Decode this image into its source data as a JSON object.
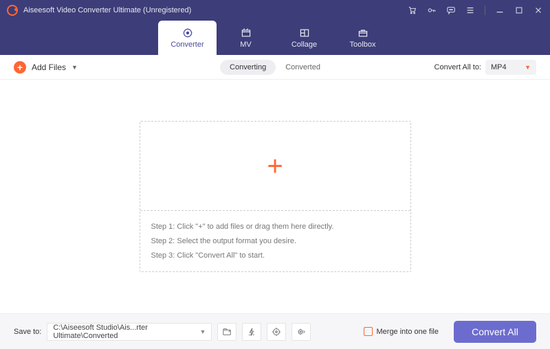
{
  "titlebar": {
    "title": "Aiseesoft Video Converter Ultimate (Unregistered)"
  },
  "nav": {
    "tabs": [
      {
        "label": "Converter",
        "icon": "converter-icon"
      },
      {
        "label": "MV",
        "icon": "mv-icon"
      },
      {
        "label": "Collage",
        "icon": "collage-icon"
      },
      {
        "label": "Toolbox",
        "icon": "toolbox-icon"
      }
    ]
  },
  "toolbar": {
    "add_files_label": "Add Files",
    "subtabs": {
      "converting": "Converting",
      "converted": "Converted"
    },
    "convert_all_to_label": "Convert All to:",
    "format_selected": "MP4"
  },
  "dropzone": {
    "step1": "Step 1: Click \"+\" to add files or drag them here directly.",
    "step2": "Step 2: Select the output format you desire.",
    "step3": "Step 3: Click \"Convert All\" to start."
  },
  "bottombar": {
    "save_to_label": "Save to:",
    "path": "C:\\Aiseesoft Studio\\Ais...rter Ultimate\\Converted",
    "merge_label": "Merge into one file",
    "convert_all_button": "Convert All"
  }
}
